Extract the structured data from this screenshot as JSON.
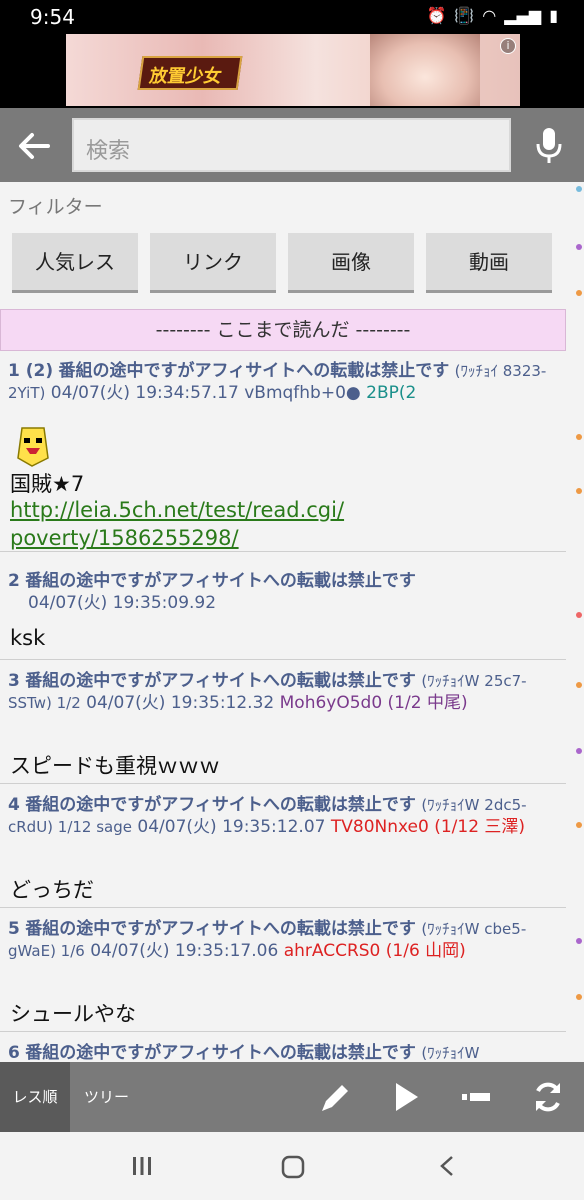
{
  "status": {
    "time": "9:54"
  },
  "ad": {
    "logo_text": "放置少女",
    "info": "i"
  },
  "search": {
    "placeholder": "検索"
  },
  "filter": {
    "label": "フィルター",
    "buttons": [
      "人気レス",
      "リンク",
      "画像",
      "動画"
    ]
  },
  "read_marker": "-------- ここまで読んだ --------",
  "posts": [
    {
      "num": "1 (2)",
      "name": "番組の途中ですがアフィサイトへの転載は禁止です",
      "trip": "(ﾜｯﾁｮｲ 8323-2YiT)",
      "date": "04/07(火) 19:34:57.17",
      "id": "vBmqfhb+0●",
      "id_extra": "2BP(2",
      "body_line1": "国賊★7",
      "link_line1": "http://leia.5ch.net/test/read.cgi/",
      "link_line2": "poverty/1586255298/"
    },
    {
      "num": "2",
      "name": "番組の途中ですがアフィサイトへの転載は禁止です",
      "date": "04/07(火) 19:35:09.92",
      "body": "ksk"
    },
    {
      "num": "3",
      "name": "番組の途中ですがアフィサイトへの転載は禁止です",
      "trip": "(ﾜｯﾁｮｲW 25c7-SSTw) 1/2",
      "date": "04/07(火) 19:35:12.32",
      "id": "Moh6yO5d0 (1/2 中尾)",
      "body": "スピードも重視ｗｗｗ"
    },
    {
      "num": "4",
      "name": "番組の途中ですがアフィサイトへの転載は禁止です",
      "trip": "(ﾜｯﾁｮｲW 2dc5-cRdU) 1/12 sage",
      "date": "04/07(火) 19:35:12.07",
      "id": "TV80Nnxe0 (1/12 三澤)",
      "body": "どっちだ"
    },
    {
      "num": "5",
      "name": "番組の途中ですがアフィサイトへの転載は禁止です",
      "trip": "(ﾜｯﾁｮｲW cbe5-gWaE) 1/6",
      "date": "04/07(火) 19:35:17.06",
      "id": "ahrACCRS0 (1/6 山岡)",
      "body": "シュールやな"
    },
    {
      "num": "6",
      "name": "番組の途中ですがアフィサイトへの転載は禁止です",
      "trip": "(ﾜｯﾁｮｲW"
    }
  ],
  "toolbar": {
    "tab_active": "レス順",
    "tab_tree": "ツリー"
  },
  "colors": {
    "accent_bar": "#7a7a7a",
    "read_marker_bg": "#f6d9f4",
    "name": "#4c5f8c",
    "id_red": "#dd2222",
    "link": "#2a7a1a"
  }
}
